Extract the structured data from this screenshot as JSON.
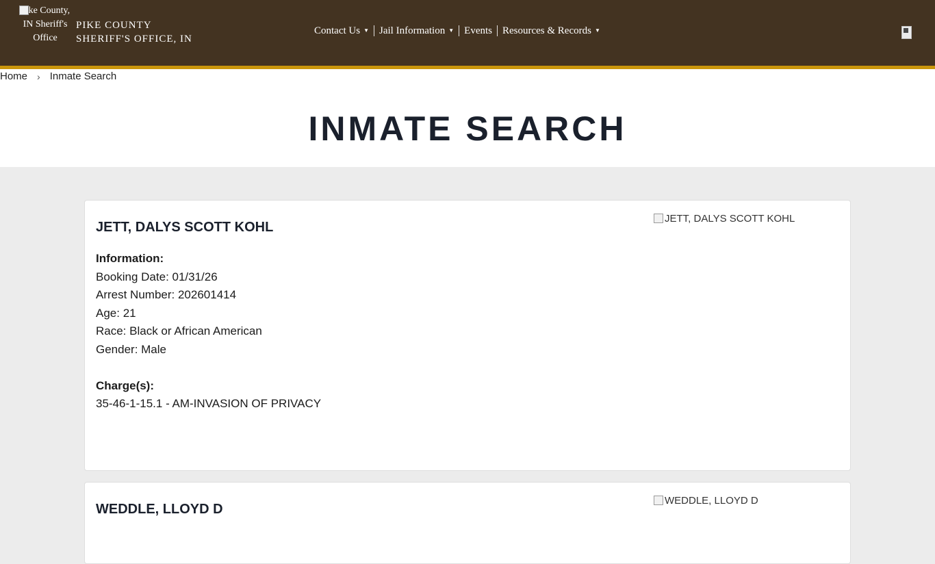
{
  "header": {
    "logo_alt": "Pike County, IN Sheriff's Office",
    "title_line1": "PIKE COUNTY",
    "title_line2": "SHERIFF'S OFFICE, IN",
    "nav": [
      {
        "label": "Contact Us",
        "dropdown": true
      },
      {
        "label": "Jail Information",
        "dropdown": true
      },
      {
        "label": "Events",
        "dropdown": false
      },
      {
        "label": "Resources & Records",
        "dropdown": true
      }
    ],
    "colors": {
      "background": "#433321",
      "accent": "#c9960c"
    }
  },
  "breadcrumb": {
    "home": "Home",
    "separator": "›",
    "current": "Inmate Search"
  },
  "page_title": "INMATE SEARCH",
  "inmates": [
    {
      "name": "JETT, DALYS SCOTT KOHL",
      "info_label": "Information:",
      "booking_date": "Booking Date: 01/31/26",
      "arrest_number": "Arrest Number: 202601414",
      "age": "Age: 21",
      "race": "Race: Black or African American",
      "gender": "Gender: Male",
      "charges_label": "Charge(s):",
      "charges": [
        "35-46-1-15.1 - AM-INVASION OF PRIVACY"
      ],
      "photo_alt": "JETT, DALYS SCOTT KOHL"
    },
    {
      "name": "WEDDLE, LLOYD D",
      "photo_alt": "WEDDLE, LLOYD D"
    }
  ]
}
